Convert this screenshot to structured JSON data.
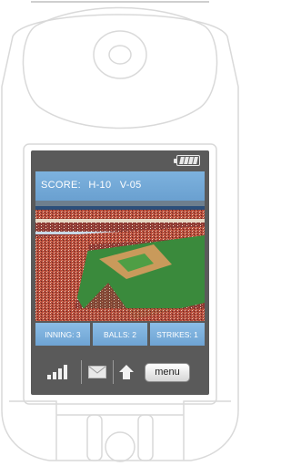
{
  "scoreboard": {
    "score_label": "SCORE:",
    "home": "H-10",
    "visitor": "V-05"
  },
  "stats": {
    "inning": "INNING: 3",
    "balls": "BALLS: 2",
    "strikes": "STRIKES: 1"
  },
  "toolbar": {
    "signal_icon": "signal-strength-icon",
    "mail_icon": "mail-icon",
    "home_icon": "home-icon",
    "menu_label": "menu"
  },
  "battery_icon": "battery-icon",
  "colors": {
    "accent": "#7db2de",
    "screen_bg": "#5a5a5a",
    "outline": "#d9d9d9"
  }
}
